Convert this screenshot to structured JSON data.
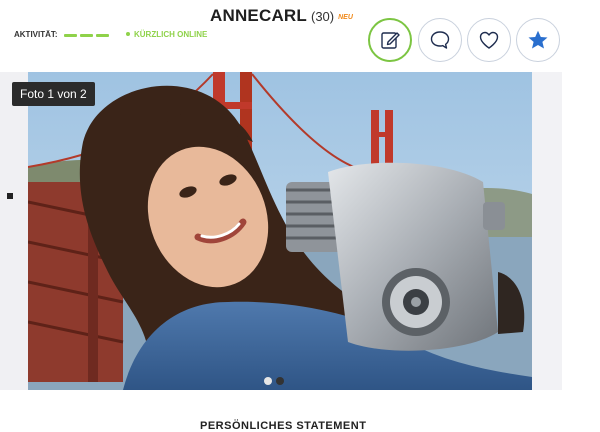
{
  "profile": {
    "name": "ANNECARL",
    "age": "(30)",
    "new_badge": "NEU",
    "activity_label": "AKTIVITÄT:",
    "activity_level_bars": 3,
    "online_status": "KÜRZLICH ONLINE"
  },
  "actions": [
    {
      "name": "edit",
      "icon": "edit-icon",
      "active": true
    },
    {
      "name": "chat",
      "icon": "chat-bubble-icon",
      "active": false
    },
    {
      "name": "like",
      "icon": "heart-icon",
      "active": false
    },
    {
      "name": "favorite",
      "icon": "star-icon",
      "active": false
    }
  ],
  "gallery": {
    "counter": "Foto 1 von 2",
    "total": 2,
    "current": 1
  },
  "section": {
    "statement_heading": "PERSÖNLICHES STATEMENT"
  },
  "colors": {
    "accent_green": "#7cc542",
    "star_blue": "#2a6fce",
    "new_orange": "#f08a1c"
  }
}
